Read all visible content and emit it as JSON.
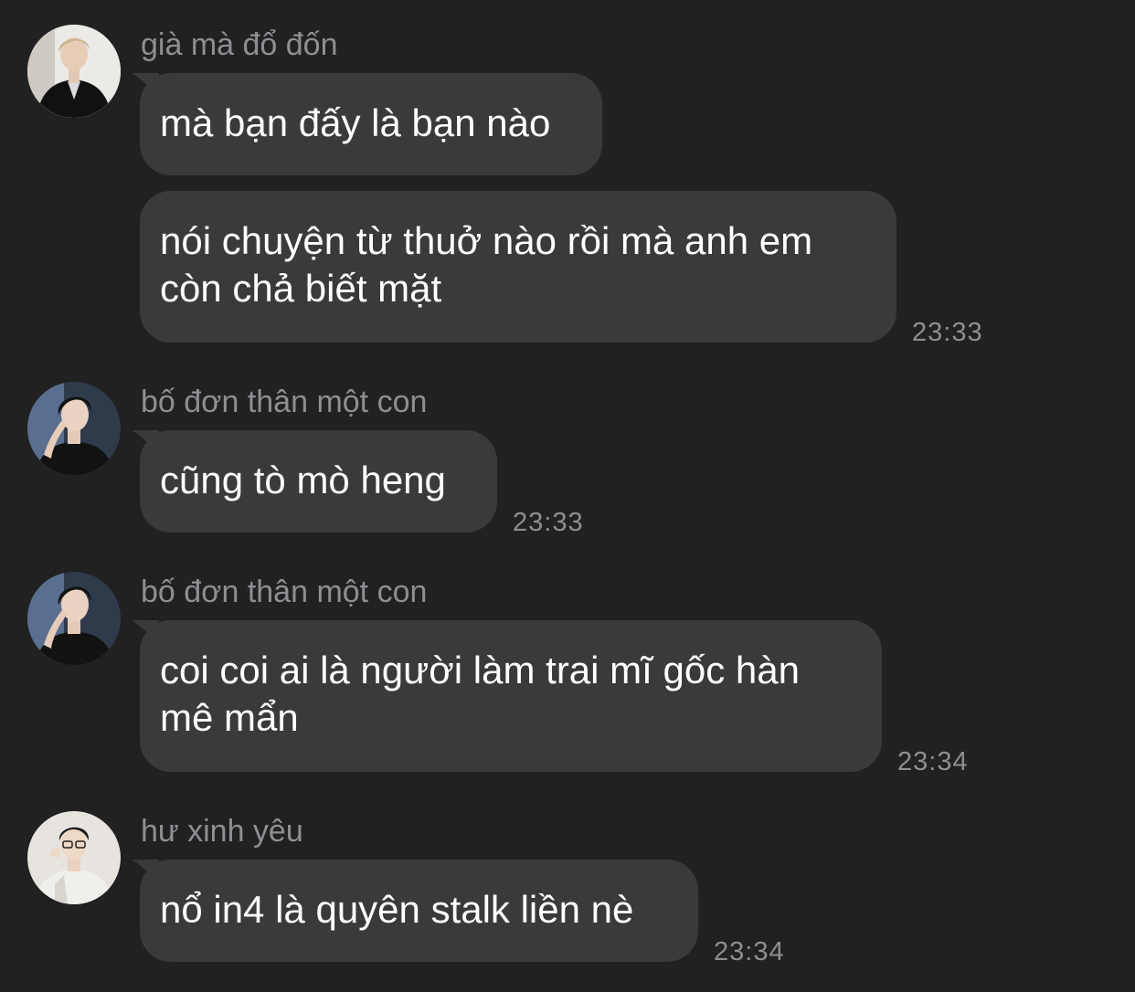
{
  "messages": [
    {
      "sender": "già mà đổ đốn",
      "avatar": "avatar-photo-man-black-jacket",
      "bubbles": [
        {
          "text": "mà bạn đấy là bạn nào"
        },
        {
          "text": "nói chuyện từ thuở nào rồi mà anh em\ncòn chả biết mặt",
          "time": "23:33"
        }
      ]
    },
    {
      "sender": "bố đơn thân một con",
      "avatar": "avatar-photo-man-hand-on-face",
      "bubbles": [
        {
          "text": "cũng tò mò heng",
          "time": "23:33"
        }
      ]
    },
    {
      "sender": "bố đơn thân một con",
      "avatar": "avatar-photo-man-hand-on-face",
      "bubbles": [
        {
          "text": "coi coi ai là người làm trai mĩ gốc hàn\nmê mẩn",
          "time": "23:34"
        }
      ]
    },
    {
      "sender": "hư xinh yêu",
      "avatar": "avatar-photo-boy-glasses-white-jacket",
      "bubbles": [
        {
          "text": "nổ in4 là quyên stalk liền nè",
          "time": "23:34"
        }
      ]
    }
  ],
  "colors": {
    "background": "#212122",
    "bubble": "#3a3a3c",
    "secondary_text": "#8e8e93",
    "message_text": "#ffffff"
  }
}
